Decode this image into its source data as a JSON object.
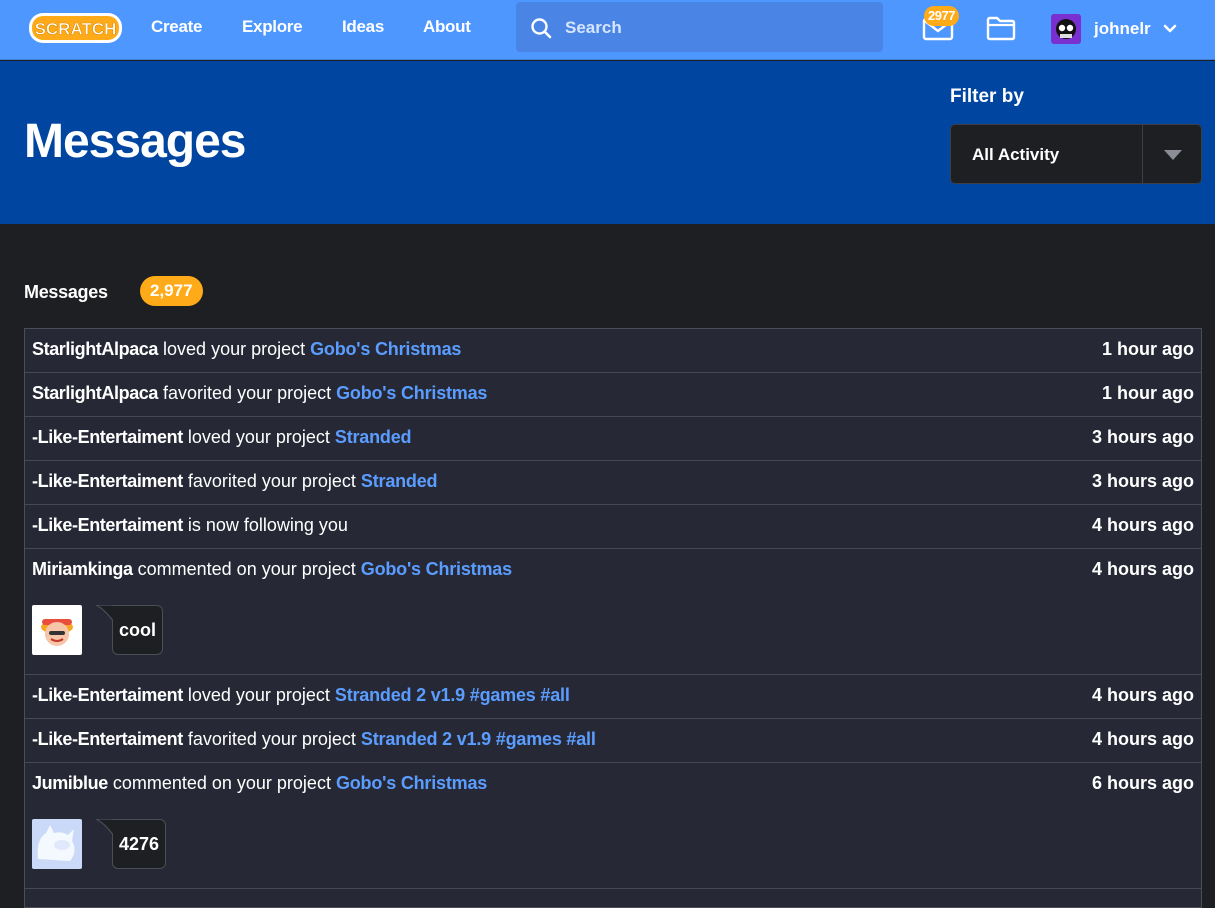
{
  "nav": {
    "logo_text": "SCRATCH",
    "links": [
      "Create",
      "Explore",
      "Ideas",
      "About"
    ],
    "search_placeholder": "Search",
    "message_count_badge": "2977",
    "username": "johnelr"
  },
  "header": {
    "title": "Messages",
    "filter_label": "Filter by",
    "filter_value": "All Activity"
  },
  "messages_section": {
    "title": "Messages",
    "count": "2,977",
    "items": [
      {
        "actor": "StarlightAlpaca",
        "action": " loved your project ",
        "project": "Gobo's Christmas",
        "time": "1 hour ago"
      },
      {
        "actor": "StarlightAlpaca",
        "action": " favorited your project ",
        "project": "Gobo's Christmas",
        "time": "1 hour ago"
      },
      {
        "actor": "-Like-Entertaiment",
        "action": " loved your project ",
        "project": "Stranded",
        "time": "3 hours ago"
      },
      {
        "actor": "-Like-Entertaiment",
        "action": " favorited your project ",
        "project": "Stranded",
        "time": "3 hours ago"
      },
      {
        "actor": "-Like-Entertaiment",
        "action": " is now following you",
        "project": "",
        "time": "4 hours ago"
      },
      {
        "actor": "Miriamkinga",
        "action": " commented on your project ",
        "project": "Gobo's Christmas",
        "time": "4 hours ago",
        "comment": "cool"
      },
      {
        "actor": "-Like-Entertaiment",
        "action": " loved your project ",
        "project": "Stranded 2 v1.9 #games #all",
        "time": "4 hours ago"
      },
      {
        "actor": "-Like-Entertaiment",
        "action": " favorited your project ",
        "project": "Stranded 2 v1.9 #games #all",
        "time": "4 hours ago"
      },
      {
        "actor": "Jumiblue",
        "action": " commented on your project ",
        "project": "Gobo's Christmas",
        "time": "6 hours ago",
        "comment": "4276"
      }
    ]
  },
  "colors": {
    "nav_bg": "#4d97ff",
    "header_bg": "#0045a0",
    "page_bg": "#1e1f22",
    "list_bg": "#262935",
    "link": "#5b9dff",
    "badge": "#ffab19"
  },
  "icons": [
    "scratch-logo",
    "search-icon",
    "messages-icon",
    "folder-icon",
    "user-avatar",
    "chevron-down-icon",
    "caret-down-icon"
  ]
}
